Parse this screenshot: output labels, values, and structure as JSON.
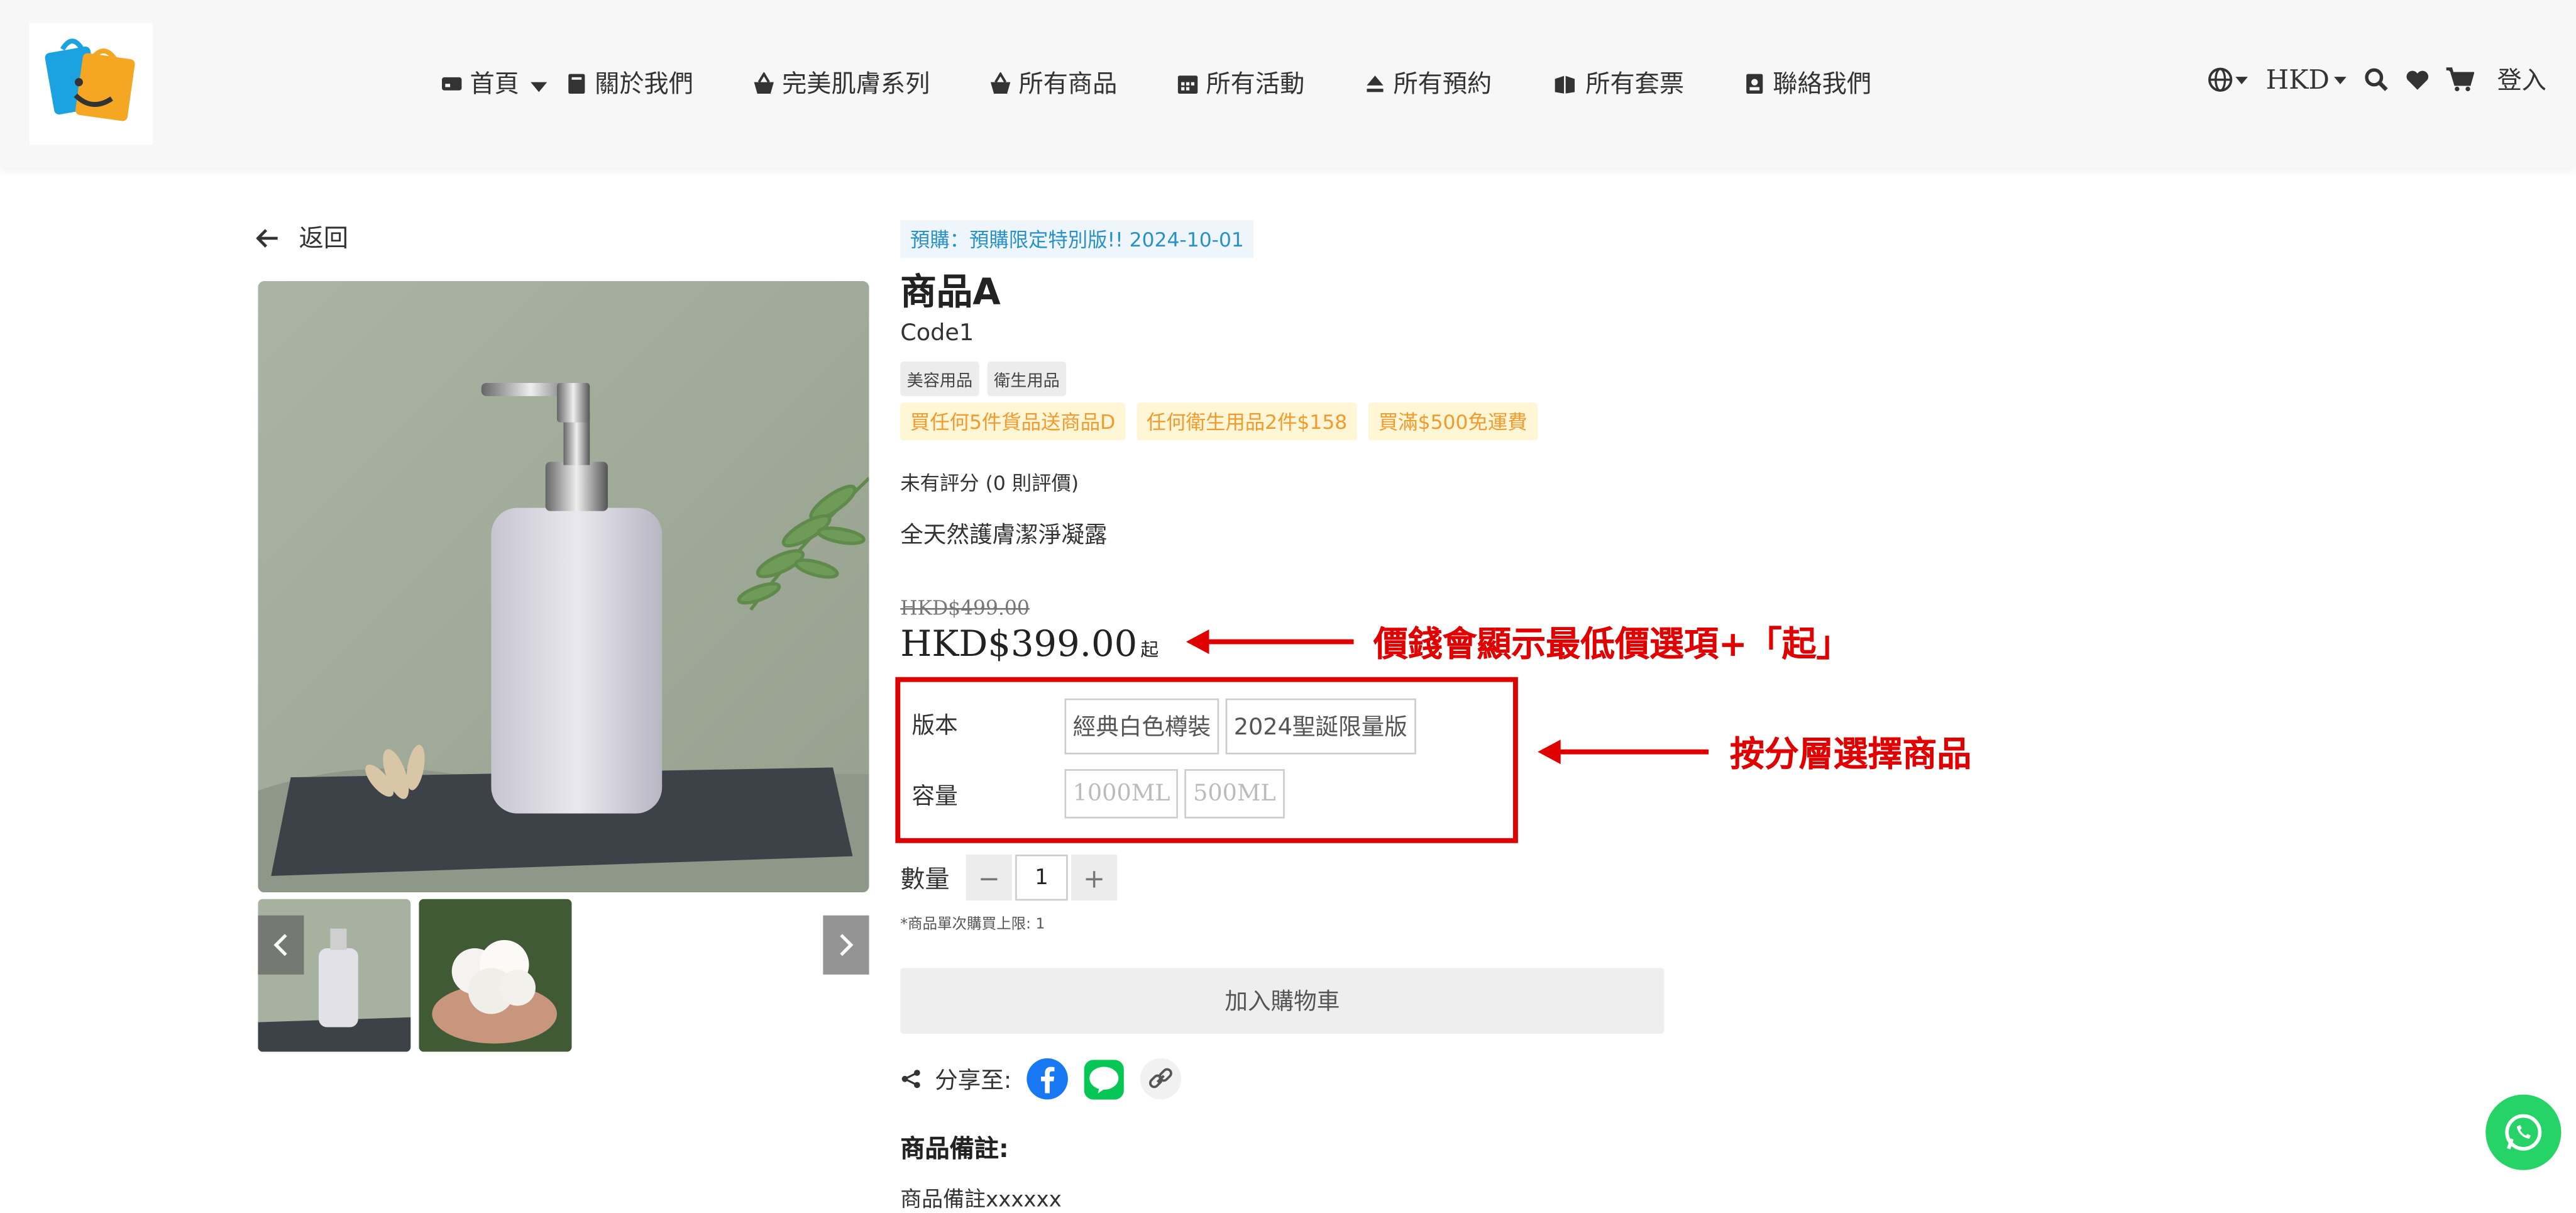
{
  "nav": {
    "home": "首頁",
    "about": "關於我們",
    "series": "完美肌膚系列",
    "products": "所有商品",
    "events": "所有活動",
    "bookings": "所有預約",
    "packages": "所有套票",
    "contact": "聯絡我們"
  },
  "header_right": {
    "currency": "HKD",
    "login": "登入"
  },
  "back": "返回",
  "product": {
    "preorder": "預購：預購限定特別版!! 2024-10-01",
    "title": "商品A",
    "code": "Code1",
    "tags": [
      "美容用品",
      "衛生用品"
    ],
    "promos": [
      "買任何5件貨品送商品D",
      "任何衛生用品2件$158",
      "買滿$500免運費"
    ],
    "rating": "未有評分 (0 則評價)",
    "description": "全天然護膚潔淨凝露",
    "old_price": "HKD$499.00",
    "price": "HKD$399.00",
    "price_suffix": "起"
  },
  "variants": {
    "version_label": "版本",
    "version_options": [
      "經典白色樽裝",
      "2024聖誕限量版"
    ],
    "volume_label": "容量",
    "volume_options": [
      "1000ML",
      "500ML"
    ]
  },
  "quantity": {
    "label": "數量",
    "value": "1",
    "minus": "−",
    "plus": "+",
    "limit": "*商品單次購買上限: 1"
  },
  "cart_button": "加入購物車",
  "share_label": "分享至:",
  "remarks": {
    "title": "商品備註:",
    "text": "商品備註xxxxxx"
  },
  "annotations": {
    "price_note": "價錢會顯示最低價選項+「起」",
    "variant_note": "按分層選擇商品"
  },
  "colors": {
    "annotation": "#e00000",
    "preorder": "#2a90c8",
    "promo": "#f29a2e",
    "whatsapp": "#25d366"
  }
}
